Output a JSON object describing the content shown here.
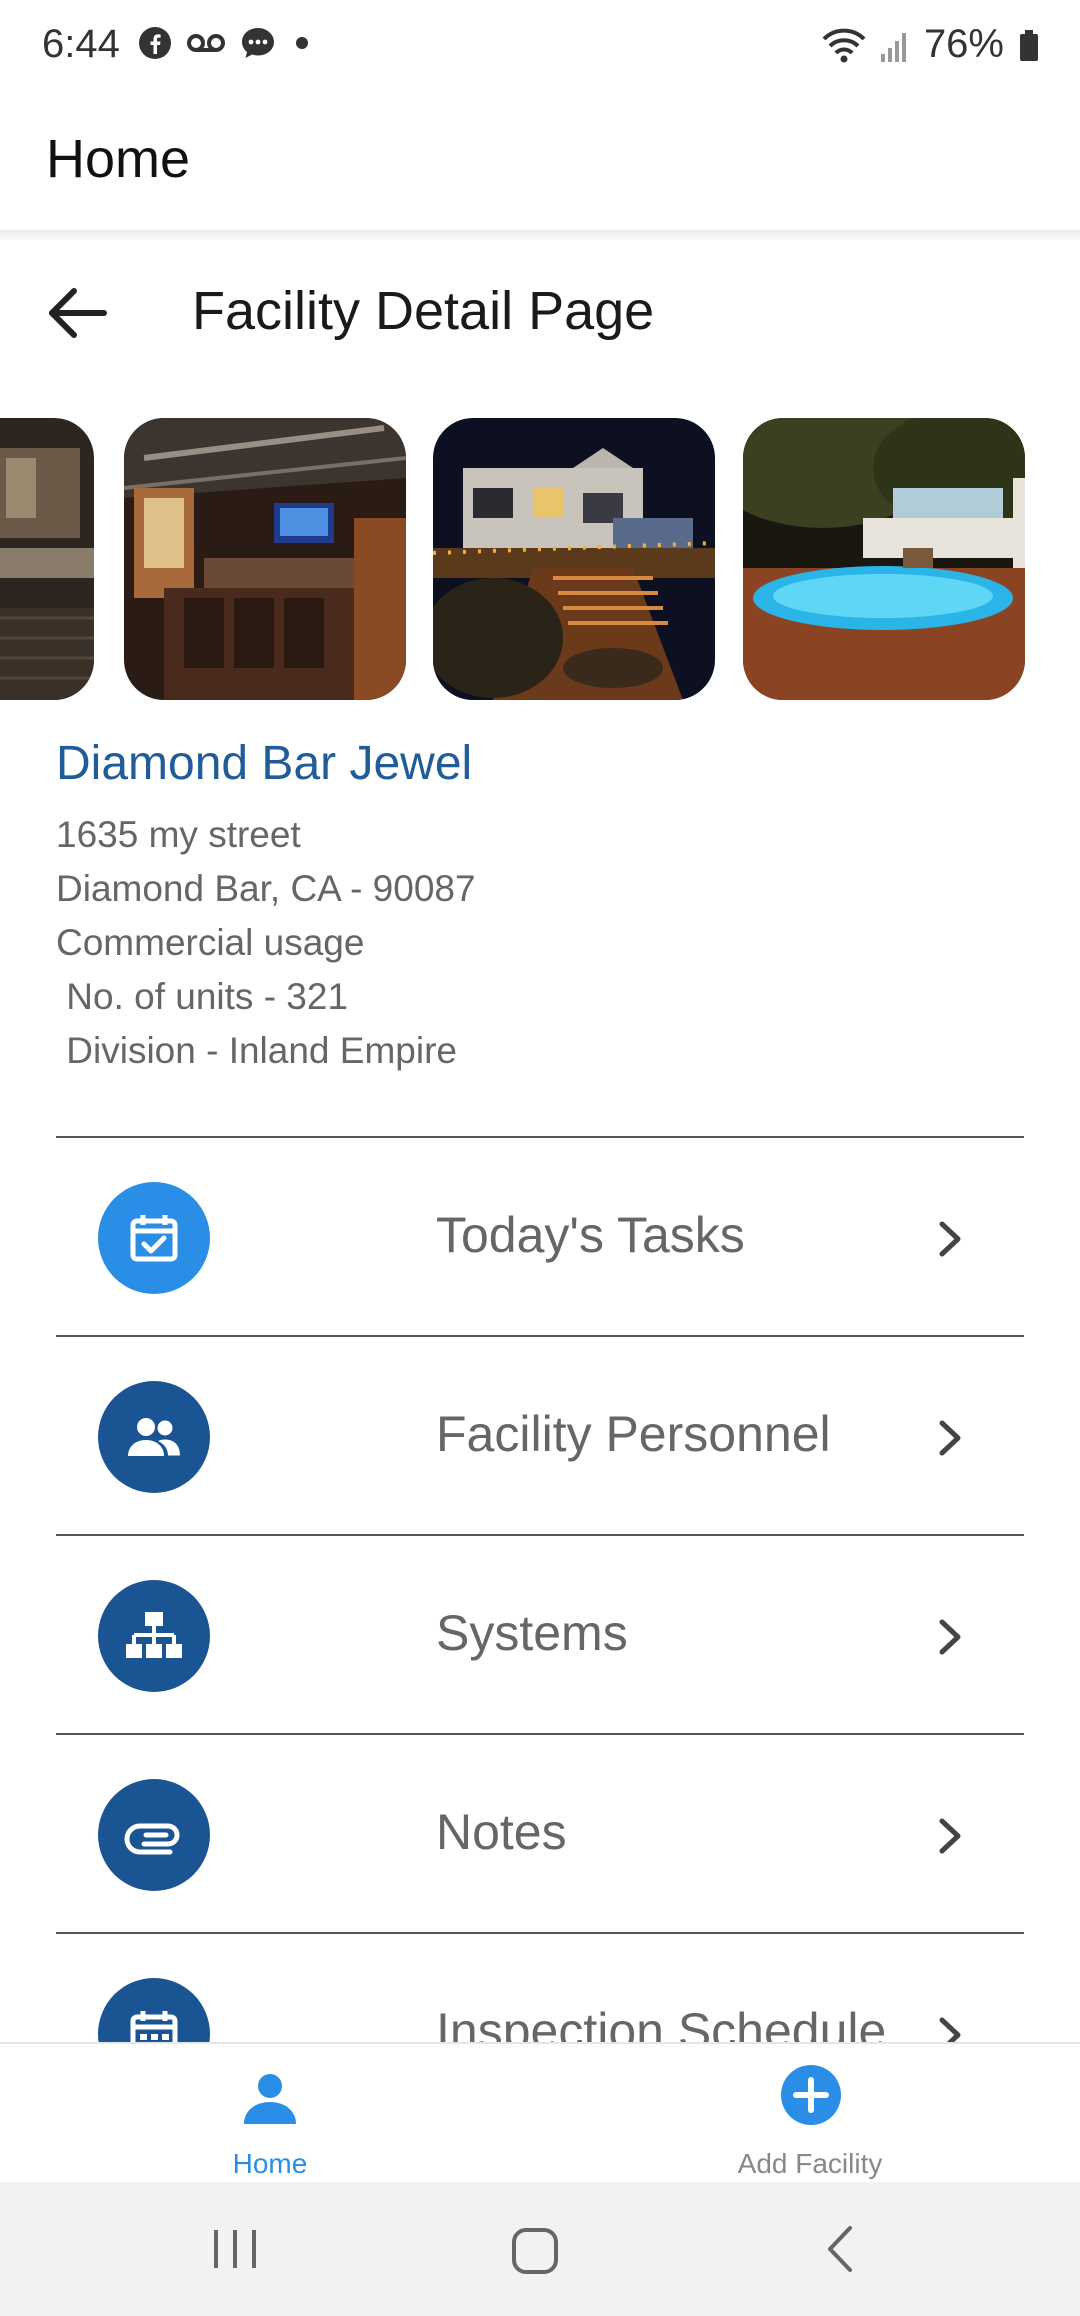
{
  "status_bar": {
    "time": "6:44",
    "battery": "76%"
  },
  "top_header": {
    "title": "Home"
  },
  "page_header": {
    "title": "Facility Detail Page"
  },
  "facility": {
    "name": "Diamond Bar Jewel",
    "address_line1": "1635 my street",
    "address_line2": "Diamond Bar, CA - 90087",
    "usage": "Commercial usage",
    "units": " No. of units - 321",
    "division": " Division - Inland Empire"
  },
  "menu": [
    {
      "label": "Today's Tasks",
      "icon": "calendar-check-icon",
      "color": "#2b8ee6"
    },
    {
      "label": "Facility Personnel",
      "icon": "people-icon",
      "color": "#1a5493"
    },
    {
      "label": "Systems",
      "icon": "hierarchy-icon",
      "color": "#1a5493"
    },
    {
      "label": "Notes",
      "icon": "paperclip-icon",
      "color": "#1a5493"
    },
    {
      "label": "Inspection Schedule",
      "icon": "calendar-icon",
      "color": "#1a5493"
    }
  ],
  "bottom_nav": {
    "home_label": "Home",
    "add_facility_label": "Add Facility",
    "active_color": "#2b8ee6",
    "inactive_color": "#888888"
  },
  "colors": {
    "accent": "#2b8ee6",
    "brand_dark": "#1a5493",
    "name_text": "#1f5c99"
  }
}
